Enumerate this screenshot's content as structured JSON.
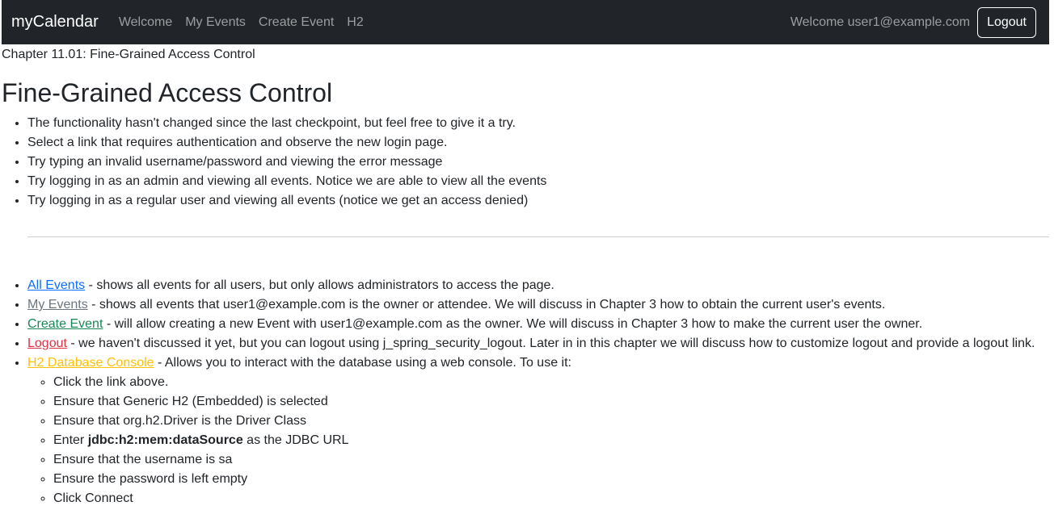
{
  "navbar": {
    "brand": "myCalendar",
    "links": [
      "Welcome",
      "My Events",
      "Create Event",
      "H2"
    ],
    "welcome_text": "Welcome user1@example.com",
    "logout_label": "Logout"
  },
  "chapter": "Chapter 11.01: Fine-Grained Access Control",
  "heading": "Fine-Grained Access Control",
  "intro_items": [
    "The functionality hasn't changed since the last checkpoint, but feel free to give it a try.",
    "Select a link that requires authentication and observe the new login page.",
    "Try typing an invalid username/password and viewing the error message",
    "Try logging in as an admin and viewing all events. Notice we are able to view all the events",
    "Try logging in as a regular user and viewing all events (notice we get an access denied)"
  ],
  "link_items": [
    {
      "link": "All Events",
      "color": "#0d6efd",
      "text": " - shows all events for all users, but only allows administrators to access the page."
    },
    {
      "link": "My Events",
      "color": "#6c757d",
      "text": " - shows all events that user1@example.com is the owner or attendee. We will discuss in Chapter 3 how to obtain the current user's events."
    },
    {
      "link": "Create Event",
      "color": "#198754",
      "text": " - will allow creating a new Event with user1@example.com as the owner. We will discuss in Chapter 3 how to make the current user the owner."
    },
    {
      "link": "Logout",
      "color": "#dc3545",
      "text": " - we haven't discussed it yet, but you can logout using j_spring_security_logout. Later in in this chapter we will discuss how to customize logout and provide a logout link."
    },
    {
      "link": "H2 Database Console",
      "color": "#ffc107",
      "text": " - Allows you to interact with the database using a web console. To use it:"
    }
  ],
  "h2_steps": {
    "click": "Click the link above.",
    "generic": "Ensure that Generic H2 (Embedded) is selected",
    "driver": "Ensure that org.h2.Driver is the Driver Class",
    "enter_prefix": "Enter ",
    "jdbc_url": "jdbc:h2:mem:dataSource",
    "enter_suffix": " as the JDBC URL",
    "username": "Ensure that the username is sa",
    "password": "Ensure the password is left empty",
    "connect": "Click Connect"
  }
}
